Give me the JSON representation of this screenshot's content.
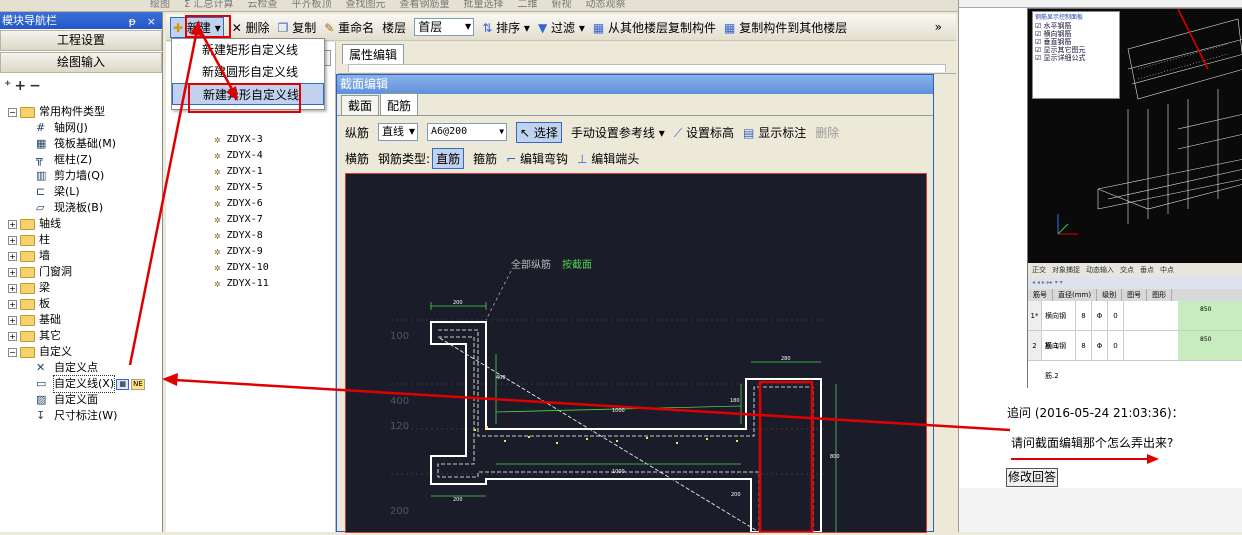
{
  "top_strip": {
    "items": [
      "绘图",
      "Σ 汇总计算",
      "云检查",
      "平齐板顶",
      "查找图元",
      "查看钢筋量",
      "批量选择",
      "二维",
      "俯视",
      "动态观察"
    ]
  },
  "left_panel": {
    "title": "模块导航栏",
    "buttons": [
      "工程设置",
      "绘图输入"
    ],
    "tree": [
      {
        "level": 0,
        "toggle": "−",
        "label": "常用构件类型",
        "type": "folder"
      },
      {
        "level": 1,
        "label": "轴网(J)",
        "icon": "grid-icon"
      },
      {
        "level": 1,
        "label": "筏板基础(M)",
        "icon": "raft-icon"
      },
      {
        "level": 1,
        "label": "框柱(Z)",
        "icon": "column-icon"
      },
      {
        "level": 1,
        "label": "剪力墙(Q)",
        "icon": "wall-icon"
      },
      {
        "level": 1,
        "label": "梁(L)",
        "icon": "beam-icon"
      },
      {
        "level": 1,
        "label": "现浇板(B)",
        "icon": "slab-icon"
      },
      {
        "level": 0,
        "toggle": "+",
        "label": "轴线",
        "type": "folder"
      },
      {
        "level": 0,
        "toggle": "+",
        "label": "柱",
        "type": "folder"
      },
      {
        "level": 0,
        "toggle": "+",
        "label": "墙",
        "type": "folder"
      },
      {
        "level": 0,
        "toggle": "+",
        "label": "门窗洞",
        "type": "folder"
      },
      {
        "level": 0,
        "toggle": "+",
        "label": "梁",
        "type": "folder"
      },
      {
        "level": 0,
        "toggle": "+",
        "label": "板",
        "type": "folder"
      },
      {
        "level": 0,
        "toggle": "+",
        "label": "基础",
        "type": "folder"
      },
      {
        "level": 0,
        "toggle": "+",
        "label": "其它",
        "type": "folder"
      },
      {
        "level": 0,
        "toggle": "−",
        "label": "自定义",
        "type": "folder"
      },
      {
        "level": 1,
        "label": "自定义点",
        "icon": "point-icon"
      },
      {
        "level": 1,
        "label": "自定义线(X)",
        "icon": "line-icon",
        "selected": true,
        "badge": "NE"
      },
      {
        "level": 1,
        "label": "自定义面",
        "icon": "face-icon"
      },
      {
        "level": 1,
        "label": "尺寸标注(W)",
        "icon": "dimension-icon"
      }
    ]
  },
  "toolbar": {
    "new_label": "新建",
    "delete_label": "删除",
    "copy_label": "复制",
    "rename_label": "重命名",
    "floor_label": "楼层",
    "floor_value": "首层",
    "sort_label": "排序",
    "filter_label": "过滤",
    "copy_from_floor": "从其他楼层复制构件",
    "copy_to_floor": "复制构件到其他楼层"
  },
  "new_menu": {
    "items": [
      "新建矩形自定义线",
      "新建圆形自定义线",
      "新建异形自定义线"
    ]
  },
  "component_list": [
    "ZDYX-3",
    "ZDYX-4",
    "ZDYX-1",
    "ZDYX-5",
    "ZDYX-6",
    "ZDYX-7",
    "ZDYX-8",
    "ZDYX-9",
    "ZDYX-10",
    "ZDYX-11"
  ],
  "properties": {
    "tab": "属性编辑"
  },
  "dialog": {
    "title": "截面编辑",
    "tabs": [
      "截面",
      "配筋"
    ],
    "row1": {
      "rebar_type": "纵筋",
      "shape": "直线",
      "spec": "A6@200",
      "select": "选择",
      "ref_line": "手动设置参考线",
      "set_elev": "设置标高",
      "show_mark": "显示标注",
      "delete": "删除"
    },
    "row2": {
      "transverse": "横筋",
      "rebar_kind_label": "钢筋类型",
      "straight": "直筋",
      "stirrup": "箍筋",
      "edit_hook": "编辑弯钩",
      "edit_end": "编辑端头"
    },
    "canvas": {
      "label_all": "全部纵筋",
      "label_section": "按截面",
      "dims": [
        "200",
        "280",
        "400",
        "1000",
        "1000",
        "200",
        "200",
        "180",
        "800"
      ],
      "left_scale": [
        "100",
        "400",
        "120",
        "200"
      ]
    }
  },
  "right_panel": {
    "legend_title": "钢筋显示控制面板",
    "legend_items": [
      "水平钢筋",
      "横向钢筋",
      "垂直钢筋",
      "显示其它图元",
      "显示详细公式"
    ],
    "shot_toolbar": [
      "正交",
      "对象捕捉",
      "动态输入",
      "交点",
      "垂点",
      "中点"
    ],
    "table_headers": [
      "筋号",
      "直径(mm)",
      "级别",
      "图号",
      "图形"
    ],
    "table_rows": [
      {
        "idx": "1*",
        "name": "横向钢筋.1",
        "dia": "8",
        "grade": "Φ",
        "fig": "0",
        "len": "850"
      },
      {
        "idx": "2",
        "name": "横向钢筋.2",
        "dia": "8",
        "grade": "Φ",
        "fig": "0",
        "len": "850"
      }
    ],
    "followup_label": "追问 (2016-05-24 21:03:36)：",
    "question": "请问截面编辑那个怎么弄出来?",
    "reply_button": "修改回答"
  },
  "colors": {
    "annotation_red": "#e00000",
    "title_blue": "#2457c5",
    "canvas_bg": "#1a1c2a",
    "rebar_yellow": "#ffe14a",
    "dim_green": "#4fd24f"
  }
}
